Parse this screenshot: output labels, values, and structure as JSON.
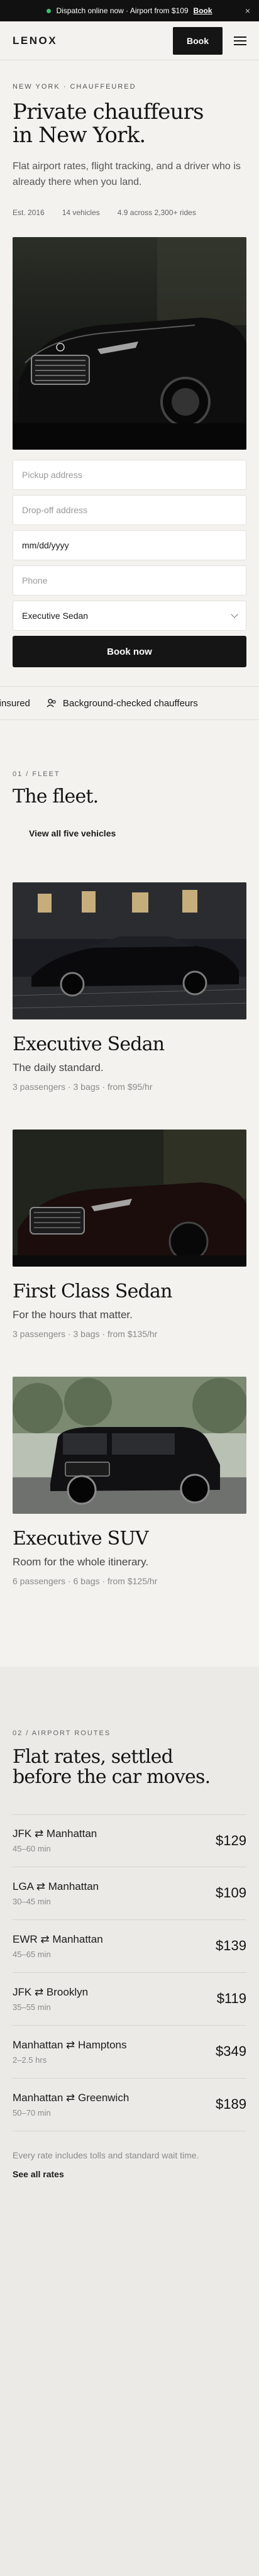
{
  "announcement": {
    "text": "Dispatch online now · Airport from $109",
    "link": "Book",
    "close": "×"
  },
  "nav": {
    "logo": "LENOX",
    "book_label": "Book"
  },
  "hero": {
    "eyebrow": "NEW YORK · CHAUFFEURED",
    "title_line1": "Private chauffeurs",
    "title_line2": "in New York.",
    "lede": "Flat airport rates, flight tracking, and a driver who is already there when you land.",
    "stats": [
      "Est. 2016",
      "14 vehicles",
      "4.9 across 2,300+ rides"
    ]
  },
  "booking": {
    "pickup_placeholder": "Pickup address",
    "dropoff_placeholder": "Drop-off address",
    "date_placeholder": "mm/dd/yyyy",
    "phone_placeholder": "Phone",
    "vehicle_selected": "Executive Sedan",
    "submit_label": "Book now"
  },
  "ticker": {
    "items": [
      "d & insured",
      "Background-checked chauffeurs"
    ]
  },
  "fleet": {
    "eyebrow": "01 / FLEET",
    "title": "The fleet.",
    "view_all": "View all five vehicles",
    "cars": [
      {
        "name": "Executive Sedan",
        "tagline": "The daily standard.",
        "meta": "3 passengers · 3 bags · from $95/hr"
      },
      {
        "name": "First Class Sedan",
        "tagline": "For the hours that matter.",
        "meta": "3 passengers · 3 bags · from $135/hr"
      },
      {
        "name": "Executive SUV",
        "tagline": "Room for the whole itinerary.",
        "meta": "6 passengers · 6 bags · from $125/hr"
      }
    ]
  },
  "rates": {
    "eyebrow": "02 / AIRPORT ROUTES",
    "title_line1": "Flat rates, settled",
    "title_line2": "before the car moves.",
    "routes": [
      {
        "route": "JFK ⇄ Manhattan",
        "duration": "45–60 min",
        "price": "$129"
      },
      {
        "route": "LGA ⇄ Manhattan",
        "duration": "30–45 min",
        "price": "$109"
      },
      {
        "route": "EWR ⇄ Manhattan",
        "duration": "45–65 min",
        "price": "$139"
      },
      {
        "route": "JFK ⇄ Brooklyn",
        "duration": "35–55 min",
        "price": "$119"
      },
      {
        "route": "Manhattan ⇄ Hamptons",
        "duration": "2–2.5 hrs",
        "price": "$349"
      },
      {
        "route": "Manhattan ⇄ Greenwich",
        "duration": "50–70 min",
        "price": "$189"
      }
    ],
    "note": "Every rate includes tolls and standard wait time.",
    "see_all": "See all rates"
  },
  "colors": {
    "ink": "#151515",
    "page": "#f3f2ee",
    "accent_dot": "#3fbf6f"
  }
}
